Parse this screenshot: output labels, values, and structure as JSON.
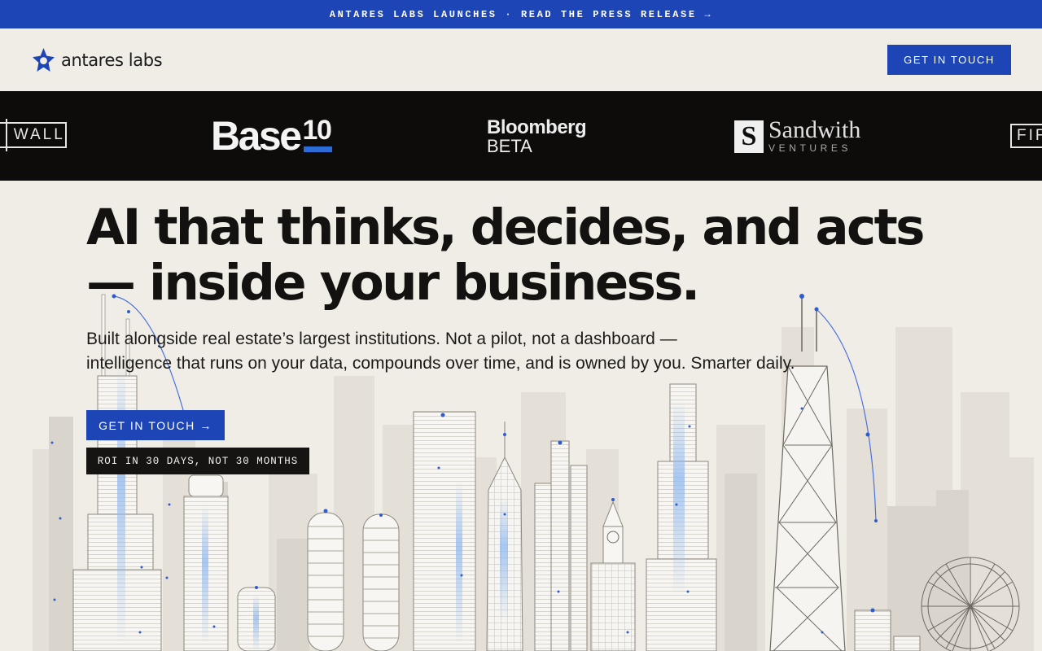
{
  "announcement": {
    "text": "ANTARES LABS LAUNCHES · READ THE PRESS RELEASE →"
  },
  "nav": {
    "logo_text": "antares labs",
    "logo_icon": "star-mark-icon",
    "cta_label": "GET IN TOUCH"
  },
  "investors": {
    "wall": {
      "left": "H",
      "right": "WALL"
    },
    "base10": {
      "word": "Base",
      "num": "10"
    },
    "bloomberg": {
      "line1": "Bloomberg",
      "line2": "BETA"
    },
    "sandwith": {
      "mark": "S",
      "line1": "Sandwith",
      "line2": "VENTURES"
    },
    "fifth": {
      "text": "FIF"
    }
  },
  "hero": {
    "title_line1": "AI that thinks, decides, and acts",
    "title_line2": "— inside your business.",
    "subtitle_line1": "Built alongside real estate’s largest institutions. Not a pilot, not a dashboard —",
    "subtitle_line2": "intelligence that runs on your data, compounds over time, and is owned by you. Smarter daily.",
    "cta_label": "GET IN TOUCH →",
    "roi_badge": "ROI IN 30 DAYS, NOT 30 MONTHS"
  },
  "colors": {
    "brand_blue": "#1e45b5",
    "background": "#f0ede6",
    "investor_band": "#0d0c0b",
    "ink": "#161412",
    "accent_line": "#4a72dd"
  }
}
